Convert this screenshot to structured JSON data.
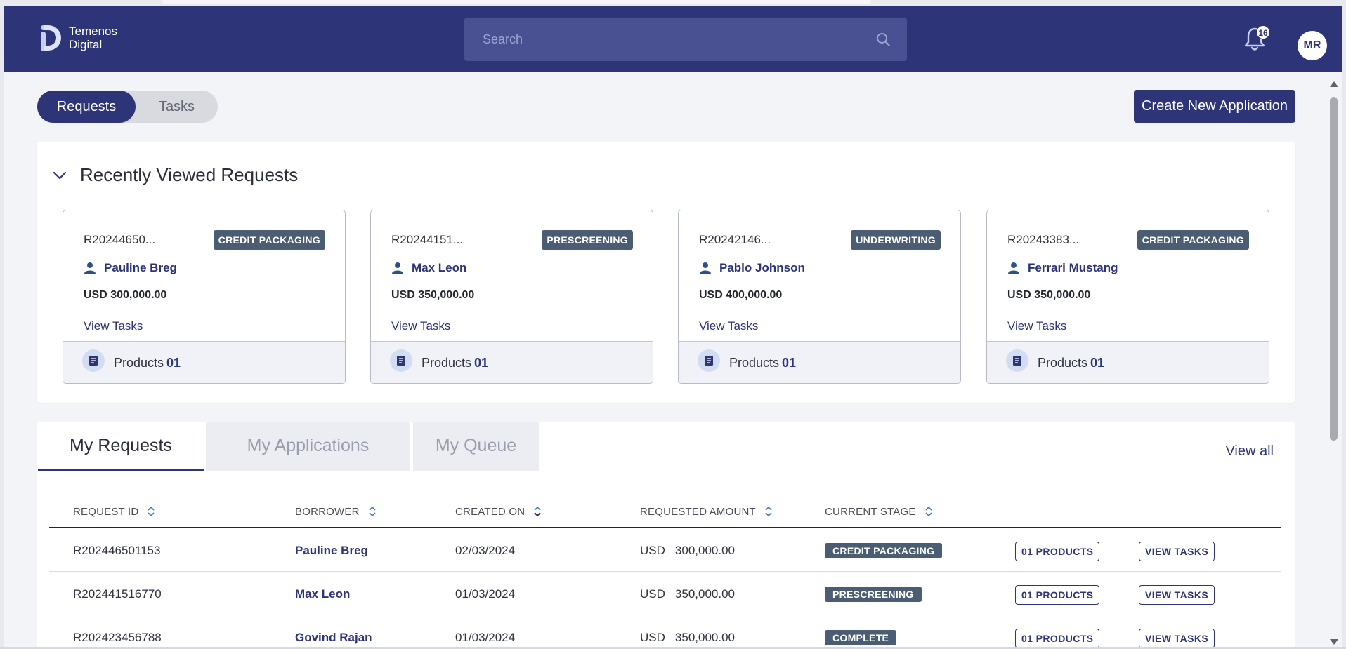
{
  "header": {
    "logo_line1": "Temenos",
    "logo_line2": "Digital",
    "search_placeholder": "Search",
    "notification_count": "16",
    "avatar_initials": "MR"
  },
  "toggle": {
    "active": "Requests",
    "inactive": "Tasks"
  },
  "create_button": "Create New Application",
  "recent": {
    "title": "Recently Viewed Requests",
    "view_tasks_label": "View Tasks",
    "products_label": "Products",
    "cards": [
      {
        "id": "R20244650...",
        "stage": "CREDIT PACKAGING",
        "borrower": "Pauline Breg",
        "amount": "USD 300,000.00",
        "products": "01"
      },
      {
        "id": "R20244151...",
        "stage": "PRESCREENING",
        "borrower": "Max Leon",
        "amount": "USD 350,000.00",
        "products": "01"
      },
      {
        "id": "R20242146...",
        "stage": "UNDERWRITING",
        "borrower": "Pablo Johnson",
        "amount": "USD 400,000.00",
        "products": "01"
      },
      {
        "id": "R20243383...",
        "stage": "CREDIT PACKAGING",
        "borrower": "Ferrari Mustang",
        "amount": "USD 350,000.00",
        "products": "01"
      }
    ]
  },
  "tabs": {
    "my_requests": "My Requests",
    "my_applications": "My Applications",
    "my_queue": "My Queue",
    "view_all": "View all"
  },
  "table": {
    "columns": {
      "request_id": "REQUEST ID",
      "borrower": "BORROWER",
      "created_on": "CREATED ON",
      "requested_amount": "REQUESTED AMOUNT",
      "current_stage": "CURRENT STAGE"
    },
    "rows": [
      {
        "id": "R202446501153",
        "borrower": "Pauline Breg",
        "created": "02/03/2024",
        "currency": "USD",
        "amount": "300,000.00",
        "stage": "CREDIT PACKAGING",
        "products_btn": "01 PRODUCTS",
        "tasks_btn": "VIEW TASKS"
      },
      {
        "id": "R202441516770",
        "borrower": "Max Leon",
        "created": "01/03/2024",
        "currency": "USD",
        "amount": "350,000.00",
        "stage": "PRESCREENING",
        "products_btn": "01 PRODUCTS",
        "tasks_btn": "VIEW TASKS"
      },
      {
        "id": "R202423456788",
        "borrower": "Govind Rajan",
        "created": "01/03/2024",
        "currency": "USD",
        "amount": "350,000.00",
        "stage": "COMPLETE",
        "products_btn": "01 PRODUCTS",
        "tasks_btn": "VIEW TASKS"
      }
    ]
  },
  "colors": {
    "brand_navy": "#2d3478",
    "stage_badge": "#4a5d72",
    "page_bg": "#f3f4f8"
  }
}
